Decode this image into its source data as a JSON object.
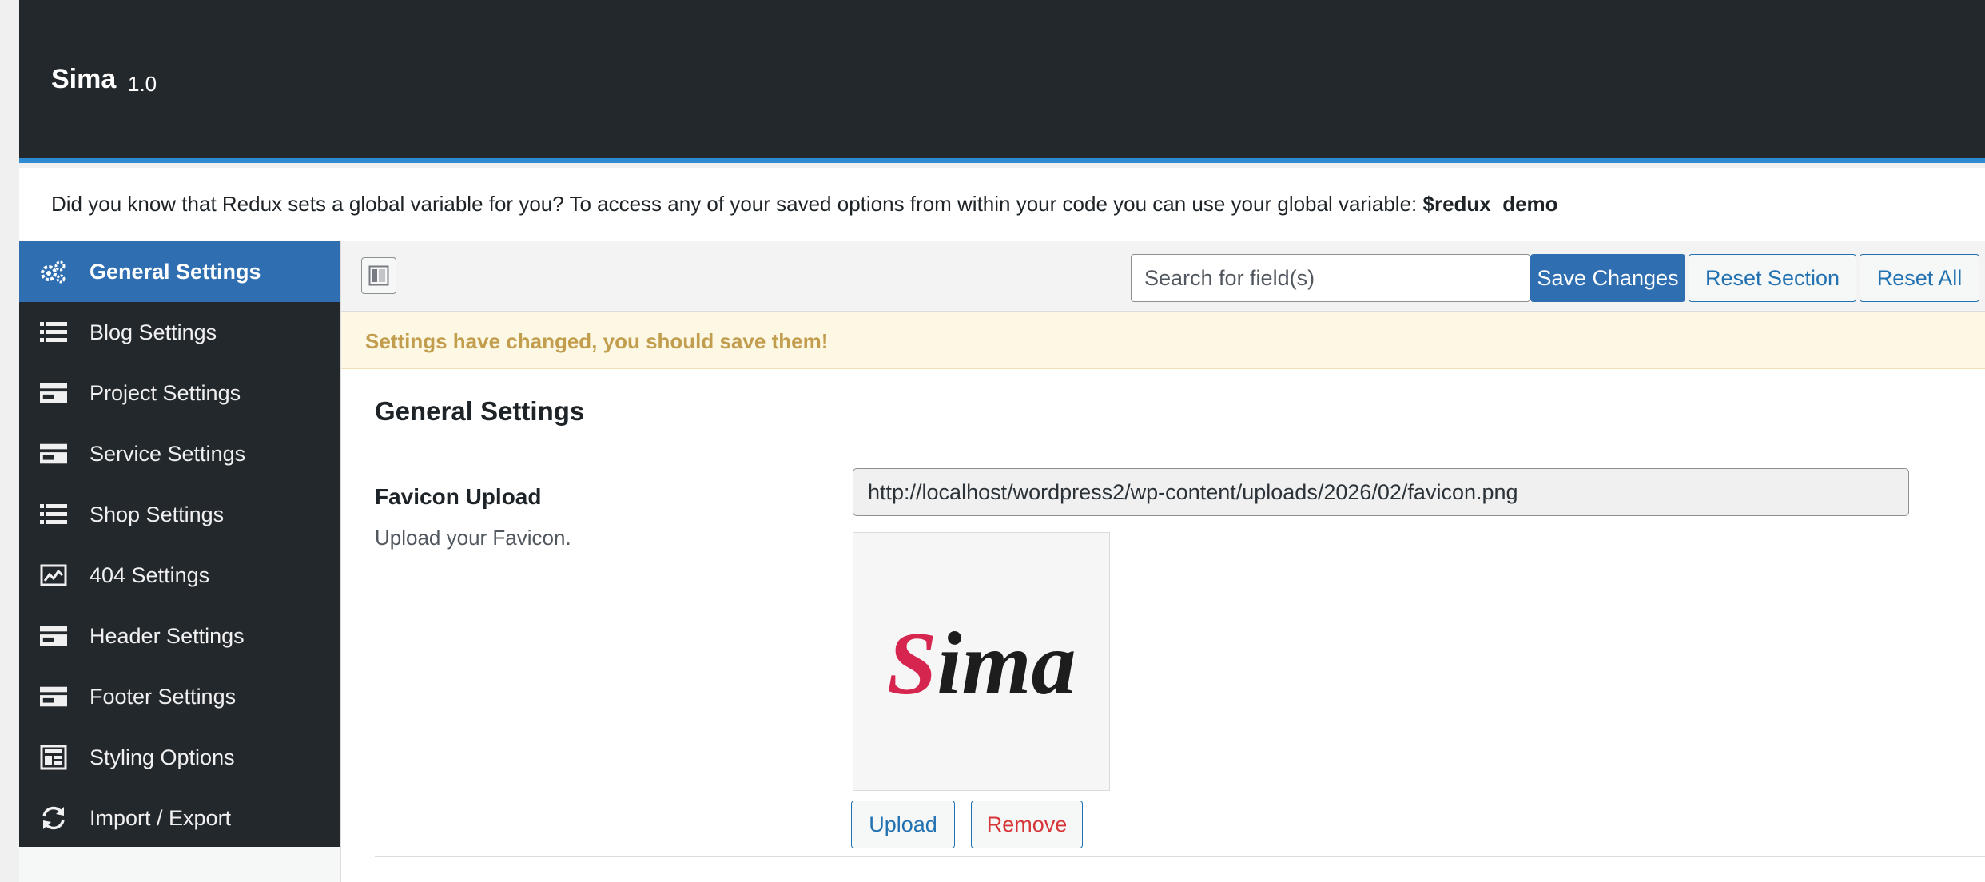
{
  "header": {
    "app_name": "Sima",
    "version": "1.0"
  },
  "notice": {
    "text": "Did you know that Redux sets a global variable for you? To access any of your saved options from within your code you can use your global variable: ",
    "variable": "$redux_demo"
  },
  "sidebar": {
    "items": [
      {
        "label": "General Settings",
        "icon": "gears-icon",
        "active": true
      },
      {
        "label": "Blog Settings",
        "icon": "list-icon",
        "active": false
      },
      {
        "label": "Project Settings",
        "icon": "card-icon",
        "active": false
      },
      {
        "label": "Service Settings",
        "icon": "card-icon",
        "active": false
      },
      {
        "label": "Shop Settings",
        "icon": "list-icon",
        "active": false
      },
      {
        "label": "404 Settings",
        "icon": "chart-icon",
        "active": false
      },
      {
        "label": "Header Settings",
        "icon": "card-icon",
        "active": false
      },
      {
        "label": "Footer Settings",
        "icon": "card-icon",
        "active": false
      },
      {
        "label": "Styling Options",
        "icon": "layout-icon",
        "active": false
      },
      {
        "label": "Import / Export",
        "icon": "refresh-icon",
        "active": false
      }
    ]
  },
  "toolbar": {
    "search_placeholder": "Search for field(s)",
    "save_label": "Save Changes",
    "reset_section_label": "Reset Section",
    "reset_all_label": "Reset All"
  },
  "changed_notice": "Settings have changed, you should save them!",
  "section": {
    "title": "General Settings"
  },
  "field": {
    "title": "Favicon Upload",
    "description": "Upload your Favicon.",
    "url": "http://localhost/wordpress2/wp-content/uploads/2026/02/favicon.png",
    "preview_text_first": "S",
    "preview_text_rest": "ima",
    "upload_label": "Upload",
    "remove_label": "Remove"
  },
  "colors": {
    "header_bg": "#23282d",
    "accent": "#2f6fb1",
    "warning_text": "#c29d4e",
    "remove_red": "#d63638",
    "logo_pink": "#d6264f"
  }
}
